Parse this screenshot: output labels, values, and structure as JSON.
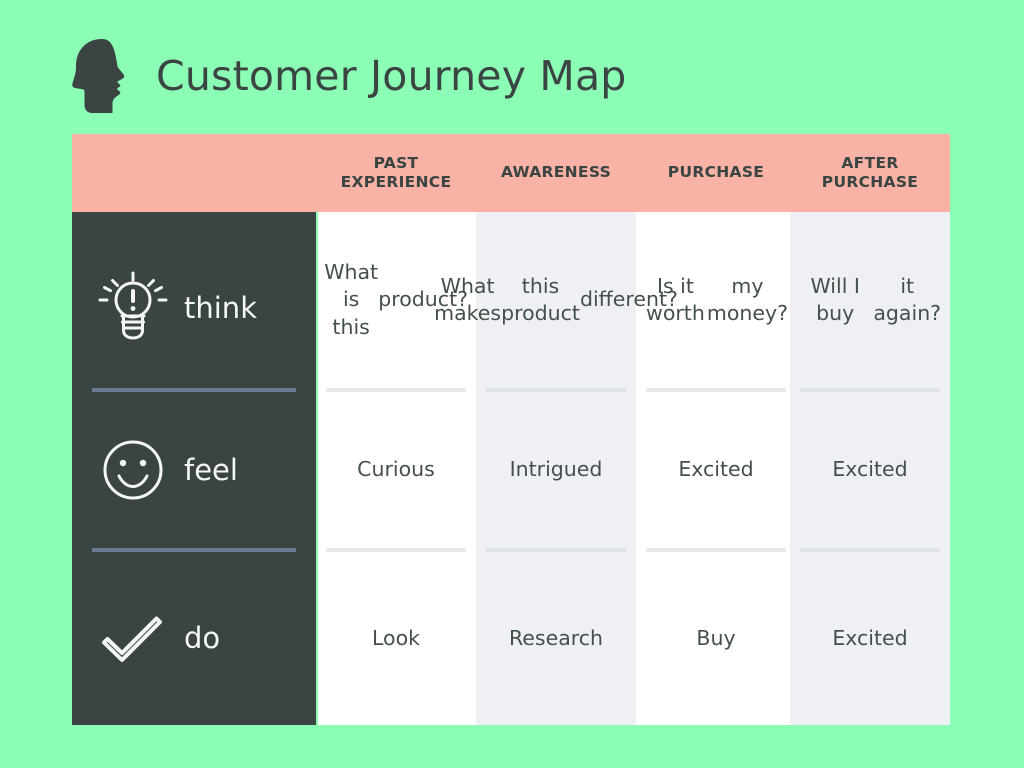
{
  "header": {
    "title": "Customer Journey Map",
    "icon": "head-silhouette-icon"
  },
  "colors": {
    "background": "#8bfdb5",
    "header_band": "#f8b3a6",
    "sidebar": "#3a4442",
    "column_white": "#ffffff",
    "column_gray": "#eef0f3",
    "sidebar_divider": "#6c7b93",
    "text_dark": "#3a4442",
    "text_light": "#f4f6f5"
  },
  "stages": [
    {
      "label_lines": [
        "PAST",
        "EXPERIENCE"
      ],
      "name": "past-experience"
    },
    {
      "label_lines": [
        "AWARENESS"
      ],
      "name": "awareness"
    },
    {
      "label_lines": [
        "PURCHASE"
      ],
      "name": "purchase"
    },
    {
      "label_lines": [
        "AFTER",
        "PURCHASE"
      ],
      "name": "after-purchase"
    }
  ],
  "rows": [
    {
      "label": "think",
      "icon": "lightbulb-idea-icon",
      "cells": [
        "What is this\nproduct?",
        "What makes\nthis product\ndifferent?",
        "Is it worth\nmy money?",
        "Will I buy\nit again?"
      ]
    },
    {
      "label": "feel",
      "icon": "smiley-face-icon",
      "cells": [
        "Curious",
        "Intrigued",
        "Excited",
        "Excited"
      ]
    },
    {
      "label": "do",
      "icon": "checkmark-icon",
      "cells": [
        "Look",
        "Research",
        "Buy",
        "Excited"
      ]
    }
  ]
}
